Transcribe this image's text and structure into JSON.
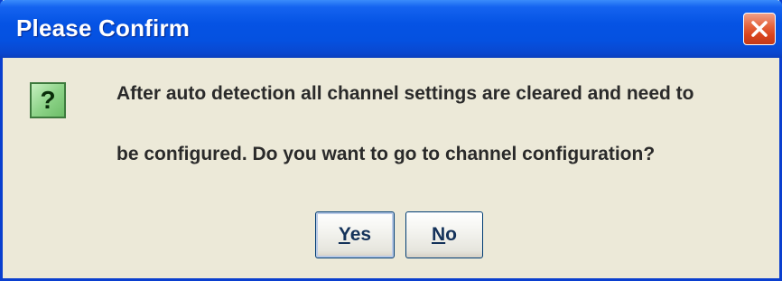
{
  "dialog": {
    "title": "Please Confirm",
    "icon": "question-icon",
    "message_line1": "After auto detection all channel settings are cleared and need to",
    "message_line2": "be configured. Do you want to go to channel configuration?",
    "buttons": {
      "yes": {
        "mnemonic": "Y",
        "rest": "es"
      },
      "no": {
        "mnemonic": "N",
        "rest": "o"
      }
    }
  },
  "colors": {
    "titlebar": "#0553e4",
    "body": "#ece9d8",
    "close": "#d9441d",
    "question_icon": "#8fd48a"
  }
}
